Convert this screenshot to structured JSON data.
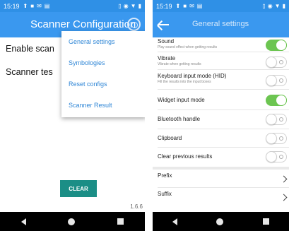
{
  "status": {
    "time": "15:19"
  },
  "left": {
    "title": "Scanner Configuration",
    "row1": "Enable scan",
    "row2": "Scanner tes",
    "menu": [
      "General settings",
      "Symbologies",
      "Reset configs",
      "Scanner Result"
    ],
    "clear_label": "CLEAR",
    "version": "1.6.6"
  },
  "right": {
    "title": "General settings",
    "settings": [
      {
        "label": "Sound",
        "sub": "Play sound effect when getting results",
        "state": "on"
      },
      {
        "label": "Vibrate",
        "sub": "Vibrate when getting results",
        "state": "off"
      },
      {
        "label": "Keyboard input mode (HID)",
        "sub": "Fill the results into the input boxes",
        "state": "off"
      },
      {
        "label": "Widget input mode",
        "sub": "",
        "state": "on"
      },
      {
        "label": "Bluetooth handle",
        "sub": "",
        "state": "off"
      },
      {
        "label": "Clipboard",
        "sub": "",
        "state": "off"
      },
      {
        "label": "Clear previous results",
        "sub": "",
        "state": "off"
      }
    ],
    "nav_items": [
      "Prefix",
      "Suffix"
    ]
  },
  "colors": {
    "statusbar": "#2f90e6",
    "appbar": "#3a98ef",
    "toggle_on": "#6cc551",
    "clear_button": "#1b8e86",
    "menu_text": "#2f86d6"
  }
}
